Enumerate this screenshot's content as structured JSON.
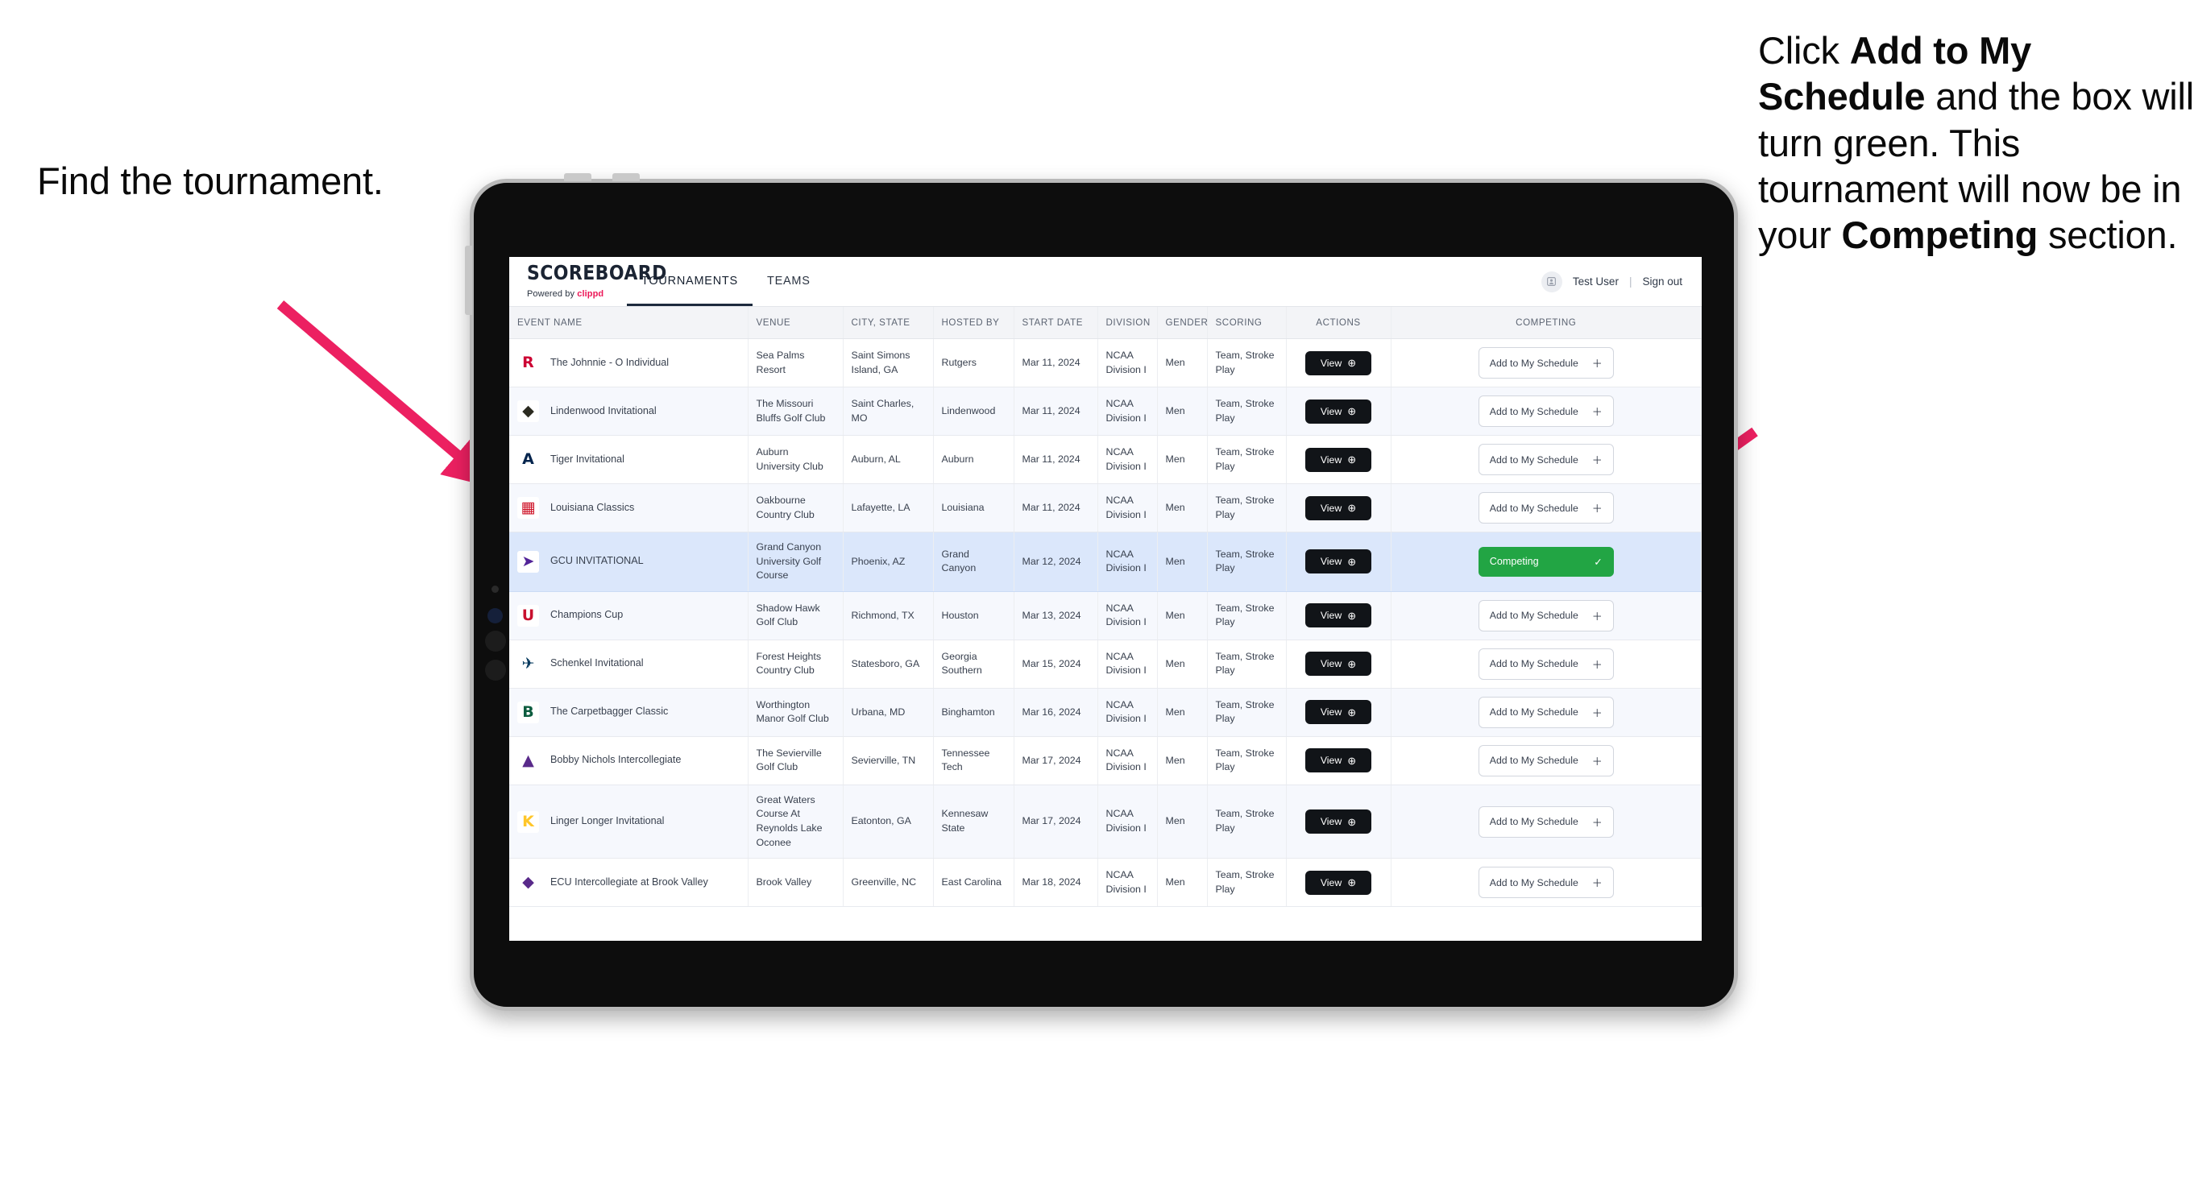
{
  "annotations": {
    "left": "Find the tournament.",
    "right_parts": [
      {
        "t": "Click ",
        "b": false
      },
      {
        "t": "Add to My Schedule",
        "b": true
      },
      {
        "t": " and the box will turn green. This tournament will now be in your ",
        "b": false
      },
      {
        "t": "Competing",
        "b": true
      },
      {
        "t": " section.",
        "b": false
      }
    ],
    "arrow_color": "#ec2061"
  },
  "app": {
    "brand": {
      "word": "SCOREBOARD",
      "powered_prefix": "Powered by ",
      "powered_brand": "clippd"
    },
    "nav": [
      {
        "label": "TOURNAMENTS",
        "active": true
      },
      {
        "label": "TEAMS",
        "active": false
      }
    ],
    "user": {
      "avatar_icon": "user-badge-icon",
      "name": "Test User",
      "separator": "|",
      "signout": "Sign out"
    },
    "table": {
      "columns": [
        "EVENT NAME",
        "VENUE",
        "CITY, STATE",
        "HOSTED BY",
        "START DATE",
        "DIVISION",
        "GENDER",
        "SCORING",
        "ACTIONS",
        "COMPETING"
      ],
      "action_view_label": "View",
      "action_view_icon": "arrow-right-circle-icon",
      "add_label": "Add to My Schedule",
      "add_icon": "plus-icon",
      "competing_label": "Competing",
      "competing_icon": "check-icon",
      "competing_color": "#22a544",
      "rows": [
        {
          "logo": "rutgers-logo",
          "event": "The Johnnie - O Individual",
          "venue": "Sea Palms Resort",
          "city": "Saint Simons Island, GA",
          "host": "Rutgers",
          "date": "Mar 11, 2024",
          "division": "NCAA Division I",
          "gender": "Men",
          "scoring": "Team, Stroke Play",
          "competing": false
        },
        {
          "logo": "lindenwood-logo",
          "event": "Lindenwood Invitational",
          "venue": "The Missouri Bluffs Golf Club",
          "city": "Saint Charles, MO",
          "host": "Lindenwood",
          "date": "Mar 11, 2024",
          "division": "NCAA Division I",
          "gender": "Men",
          "scoring": "Team, Stroke Play",
          "competing": false
        },
        {
          "logo": "auburn-logo",
          "event": "Tiger Invitational",
          "venue": "Auburn University Club",
          "city": "Auburn, AL",
          "host": "Auburn",
          "date": "Mar 11, 2024",
          "division": "NCAA Division I",
          "gender": "Men",
          "scoring": "Team, Stroke Play",
          "competing": false
        },
        {
          "logo": "louisiana-logo",
          "event": "Louisiana Classics",
          "venue": "Oakbourne Country Club",
          "city": "Lafayette, LA",
          "host": "Louisiana",
          "date": "Mar 11, 2024",
          "division": "NCAA Division I",
          "gender": "Men",
          "scoring": "Team, Stroke Play",
          "competing": false
        },
        {
          "logo": "grandcanyon-logo",
          "event": "GCU INVITATIONAL",
          "venue": "Grand Canyon University Golf Course",
          "city": "Phoenix, AZ",
          "host": "Grand Canyon",
          "date": "Mar 12, 2024",
          "division": "NCAA Division I",
          "gender": "Men",
          "scoring": "Team, Stroke Play",
          "competing": true
        },
        {
          "logo": "houston-logo",
          "event": "Champions Cup",
          "venue": "Shadow Hawk Golf Club",
          "city": "Richmond, TX",
          "host": "Houston",
          "date": "Mar 13, 2024",
          "division": "NCAA Division I",
          "gender": "Men",
          "scoring": "Team, Stroke Play",
          "competing": false
        },
        {
          "logo": "georgiasouthern-logo",
          "event": "Schenkel Invitational",
          "venue": "Forest Heights Country Club",
          "city": "Statesboro, GA",
          "host": "Georgia Southern",
          "date": "Mar 15, 2024",
          "division": "NCAA Division I",
          "gender": "Men",
          "scoring": "Team, Stroke Play",
          "competing": false
        },
        {
          "logo": "binghamton-logo",
          "event": "The Carpetbagger Classic",
          "venue": "Worthington Manor Golf Club",
          "city": "Urbana, MD",
          "host": "Binghamton",
          "date": "Mar 16, 2024",
          "division": "NCAA Division I",
          "gender": "Men",
          "scoring": "Team, Stroke Play",
          "competing": false
        },
        {
          "logo": "tennesseetech-logo",
          "event": "Bobby Nichols Intercollegiate",
          "venue": "The Sevierville Golf Club",
          "city": "Sevierville, TN",
          "host": "Tennessee Tech",
          "date": "Mar 17, 2024",
          "division": "NCAA Division I",
          "gender": "Men",
          "scoring": "Team, Stroke Play",
          "competing": false
        },
        {
          "logo": "kennesaw-logo",
          "event": "Linger Longer Invitational",
          "venue": "Great Waters Course At Reynolds Lake Oconee",
          "city": "Eatonton, GA",
          "host": "Kennesaw State",
          "date": "Mar 17, 2024",
          "division": "NCAA Division I",
          "gender": "Men",
          "scoring": "Team, Stroke Play",
          "competing": false
        },
        {
          "logo": "eastcarolina-logo",
          "event": "ECU Intercollegiate at Brook Valley",
          "venue": "Brook Valley",
          "city": "Greenville, NC",
          "host": "East Carolina",
          "date": "Mar 18, 2024",
          "division": "NCAA Division I",
          "gender": "Men",
          "scoring": "Team, Stroke Play",
          "competing": false
        }
      ]
    }
  }
}
